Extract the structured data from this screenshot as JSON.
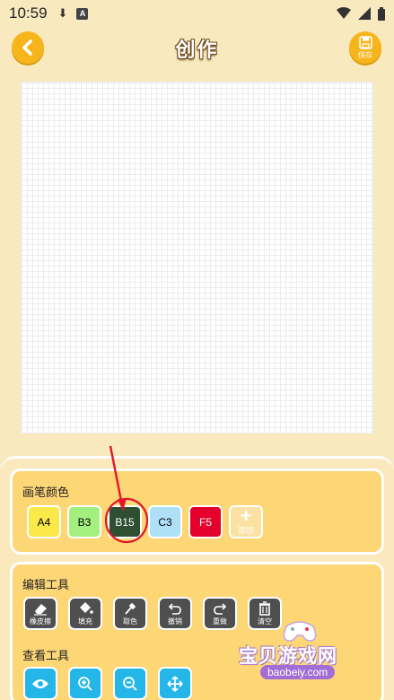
{
  "status_bar": {
    "time": "10:59",
    "icons": [
      "download-icon",
      "a-icon",
      "wifi-icon",
      "signal-icon",
      "battery-icon"
    ]
  },
  "header": {
    "title": "创作",
    "save_label": "保存",
    "back_icon": "chevron-left-icon",
    "save_icon": "floppy-disk-icon"
  },
  "brush_colors": {
    "title": "画笔颜色",
    "swatches": [
      {
        "label": "A4",
        "color": "#fbe94a"
      },
      {
        "label": "B3",
        "color": "#a3f07f"
      },
      {
        "label": "B15",
        "color": "#2f4f33"
      },
      {
        "label": "C3",
        "color": "#aee0f8"
      },
      {
        "label": "F5",
        "color": "#e5002b"
      }
    ],
    "add_label": "添加"
  },
  "edit_tools": {
    "title": "编辑工具",
    "items": [
      {
        "label": "橡皮擦",
        "icon": "eraser-icon"
      },
      {
        "label": "填充",
        "icon": "paint-bucket-icon"
      },
      {
        "label": "取色",
        "icon": "eyedropper-icon"
      },
      {
        "label": "撤销",
        "icon": "undo-icon"
      },
      {
        "label": "重做",
        "icon": "redo-icon"
      },
      {
        "label": "清空",
        "icon": "trash-icon"
      }
    ]
  },
  "view_tools": {
    "title": "查看工具",
    "items": [
      {
        "icon": "eye-icon"
      },
      {
        "icon": "zoom-in-icon"
      },
      {
        "icon": "zoom-out-icon"
      },
      {
        "icon": "move-icon"
      }
    ]
  },
  "watermark": {
    "text": "宝贝游戏网",
    "url": "baobeiy.com"
  },
  "colors": {
    "accent": "#f7b51c",
    "panel": "#fdd676",
    "tool": "#4f4f4f",
    "view_tool": "#25b6e8"
  }
}
